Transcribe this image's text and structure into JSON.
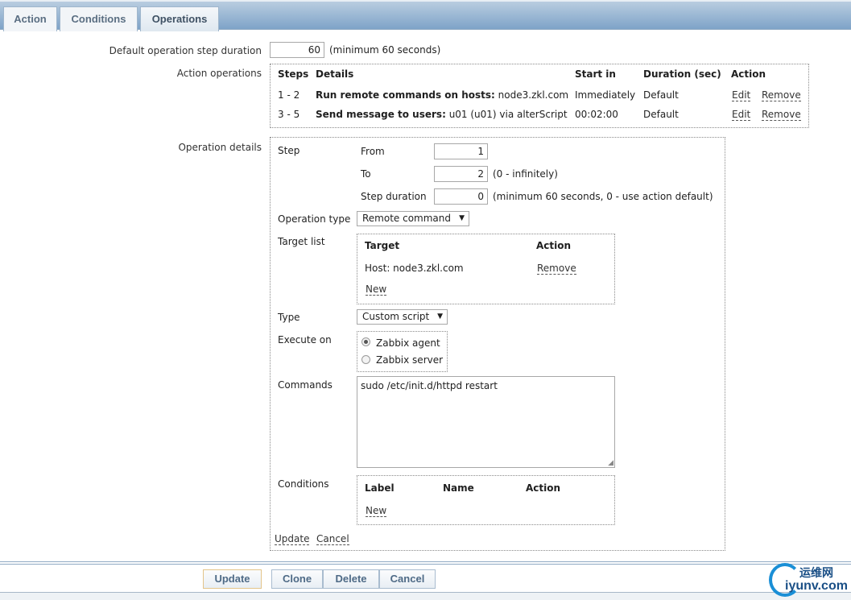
{
  "tabs": [
    {
      "label": "Action"
    },
    {
      "label": "Conditions"
    },
    {
      "label": "Operations"
    }
  ],
  "default_step": {
    "label": "Default operation step duration",
    "value": "60",
    "hint": "(minimum 60 seconds)"
  },
  "action_operations": {
    "label": "Action operations",
    "headers": [
      "Steps",
      "Details",
      "Start in",
      "Duration (sec)",
      "Action"
    ],
    "rows": [
      {
        "steps": "1 - 2",
        "detail_bold": "Run remote commands on hosts:",
        "detail": " node3.zkl.com",
        "start": "Immediately",
        "duration": "Default",
        "edit": "Edit",
        "remove": "Remove"
      },
      {
        "steps": "3 - 5",
        "detail_bold": "Send message to users:",
        "detail": " u01 (u01) via alterScript",
        "start": "00:02:00",
        "duration": "Default",
        "edit": "Edit",
        "remove": "Remove"
      }
    ]
  },
  "details": {
    "label": "Operation details",
    "step_label": "Step",
    "from_label": "From",
    "from": "1",
    "to_label": "To",
    "to": "2",
    "to_hint": "(0 - infinitely)",
    "dur_label": "Step duration",
    "dur": "0",
    "dur_hint": "(minimum 60 seconds, 0 - use action default)",
    "op_type_label": "Operation type",
    "op_type": "Remote command",
    "target_label": "Target list",
    "target_headers": [
      "Target",
      "Action"
    ],
    "target_row": "Host: node3.zkl.com",
    "target_remove": "Remove",
    "target_new": "New",
    "type_label": "Type",
    "type": "Custom script",
    "exec_label": "Execute on",
    "exec_options": [
      "Zabbix agent",
      "Zabbix server"
    ],
    "exec_selected": "Zabbix agent",
    "commands_label": "Commands",
    "commands": "sudo /etc/init.d/httpd restart",
    "cond_label": "Conditions",
    "cond_headers": [
      "Label",
      "Name",
      "Action"
    ],
    "cond_new": "New",
    "update": "Update",
    "cancel": "Cancel"
  },
  "buttons": {
    "update": "Update",
    "clone": "Clone",
    "delete": "Delete",
    "cancel": "Cancel"
  },
  "watermark": {
    "cn": "运维网",
    "en": "iyunv.com"
  }
}
